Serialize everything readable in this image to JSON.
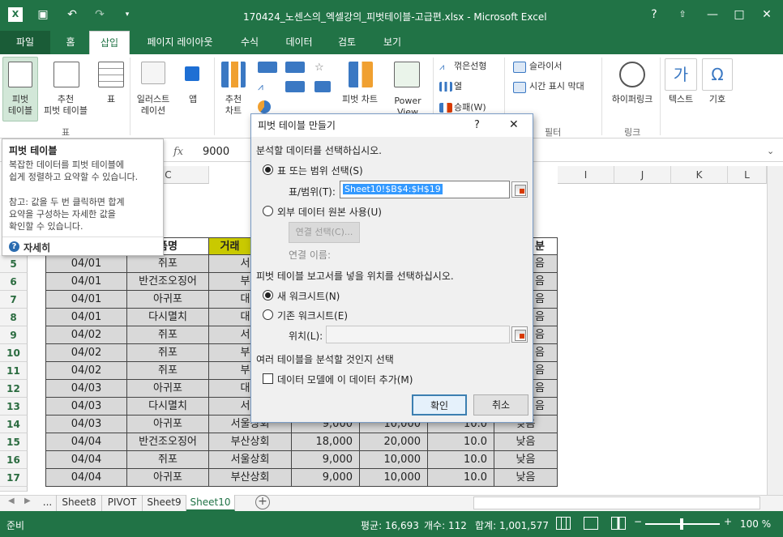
{
  "window": {
    "title": "170424_노센스의_엑셀강의_피벗테이블-고급편.xlsx - Microsoft Excel",
    "help": "?"
  },
  "tabs": [
    "파일",
    "홈",
    "삽입",
    "페이지 레이아웃",
    "수식",
    "데이터",
    "검토",
    "보기"
  ],
  "ribbon": {
    "pivot": "피벗\n테이블",
    "rec_pivot": "추천\n피벗 테이블",
    "table": "표",
    "illust": "일러스트\n레이션",
    "app": "앱",
    "rec_chart": "추천\n차트",
    "pivot_chart": "피벗 차트",
    "power_view": "Power\nView",
    "line": "꺾은선형",
    "column": "열",
    "winloss": "승패(W)",
    "slicer": "슬라이서",
    "timeline": "시간 표시 막대",
    "hyperlink": "하이퍼링크",
    "text": "텍스트",
    "symbol": "기호",
    "group_table": "표",
    "group_filter": "필터",
    "group_link": "링크"
  },
  "formula": {
    "fx": "fx",
    "value": "9000"
  },
  "columns": [
    "C",
    "I",
    "J",
    "K",
    "L"
  ],
  "tooltip": {
    "title": "피벗 테이블",
    "body": "복잡한 데이터를 피벗 테이블에\n쉽게 정렬하고 요약할 수 있습니다.",
    "note": "참고: 값을 두 번 클릭하면 합계\n요약을 구성하는 자세한 값을\n확인할 수 있습니다.",
    "more": "자세히"
  },
  "sheet": {
    "headers": [
      "품명",
      "거래",
      "분"
    ],
    "rows": [
      {
        "n": "5",
        "d": "04/01",
        "p": "쥐포",
        "c": "서울"
      },
      {
        "n": "6",
        "d": "04/01",
        "p": "반건조오징어",
        "c": "부산"
      },
      {
        "n": "7",
        "d": "04/01",
        "p": "아귀포",
        "c": "대구"
      },
      {
        "n": "8",
        "d": "04/01",
        "p": "다시멸치",
        "c": "대구"
      },
      {
        "n": "9",
        "d": "04/02",
        "p": "쥐포",
        "c": "서울"
      },
      {
        "n": "10",
        "d": "04/02",
        "p": "쥐포",
        "c": "부산"
      },
      {
        "n": "11",
        "d": "04/02",
        "p": "쥐포",
        "c": "부산"
      },
      {
        "n": "12",
        "d": "04/03",
        "p": "아귀포",
        "c": "대구"
      },
      {
        "n": "13",
        "d": "04/03",
        "p": "다시멸치",
        "c": "서울"
      },
      {
        "n": "14",
        "d": "04/03",
        "p": "아귀포",
        "c": "서울상회",
        "q": "9,000",
        "a": "10,000",
        "r": "10.0",
        "g": "낮음"
      },
      {
        "n": "15",
        "d": "04/04",
        "p": "반건조오징어",
        "c": "부산상회",
        "q": "18,000",
        "a": "20,000",
        "r": "10.0",
        "g": "낮음"
      },
      {
        "n": "16",
        "d": "04/04",
        "p": "쥐포",
        "c": "서울상회",
        "q": "9,000",
        "a": "10,000",
        "r": "10.0",
        "g": "낮음"
      },
      {
        "n": "17",
        "d": "04/04",
        "p": "아귀포",
        "c": "부산상회",
        "q": "9,000",
        "a": "10,000",
        "r": "10.0",
        "g": "낮음"
      }
    ],
    "right_vals": [
      "음",
      "음",
      "음",
      "음",
      "음",
      "음",
      "음",
      "음",
      "음"
    ]
  },
  "dialog": {
    "title": "피벗 테이블 만들기",
    "help": "?",
    "close": "✕",
    "section1": "분석할 데이터를 선택하십시오.",
    "opt_range": "표 또는 범위 선택(S)",
    "range_label": "표/범위(T):",
    "range_value": "Sheet10!$B$4:$H$19",
    "opt_external": "외부 데이터 원본 사용(U)",
    "conn_btn": "연결 선택(C)...",
    "conn_name": "연결 이름:",
    "section2": "피벗 테이블 보고서를 넣을 위치를 선택하십시오.",
    "opt_new": "새 워크시트(N)",
    "opt_existing": "기존 워크시트(E)",
    "location_label": "위치(L):",
    "section3": "여러 테이블을 분석할 것인지 선택",
    "datamodel": "데이터 모델에 이 데이터 추가(M)",
    "ok": "확인",
    "cancel": "취소"
  },
  "sheettabs": [
    "...",
    "Sheet8",
    "PIVOT",
    "Sheet9",
    "Sheet10"
  ],
  "status": {
    "ready": "준비",
    "avg": "평균: 16,693",
    "count": "개수: 112",
    "sum": "합계: 1,001,577",
    "zoom": "100 %"
  },
  "colors": {
    "green": "#217346",
    "header_yellow": "#c9c900",
    "cell_gray": "#d9d9d9"
  }
}
